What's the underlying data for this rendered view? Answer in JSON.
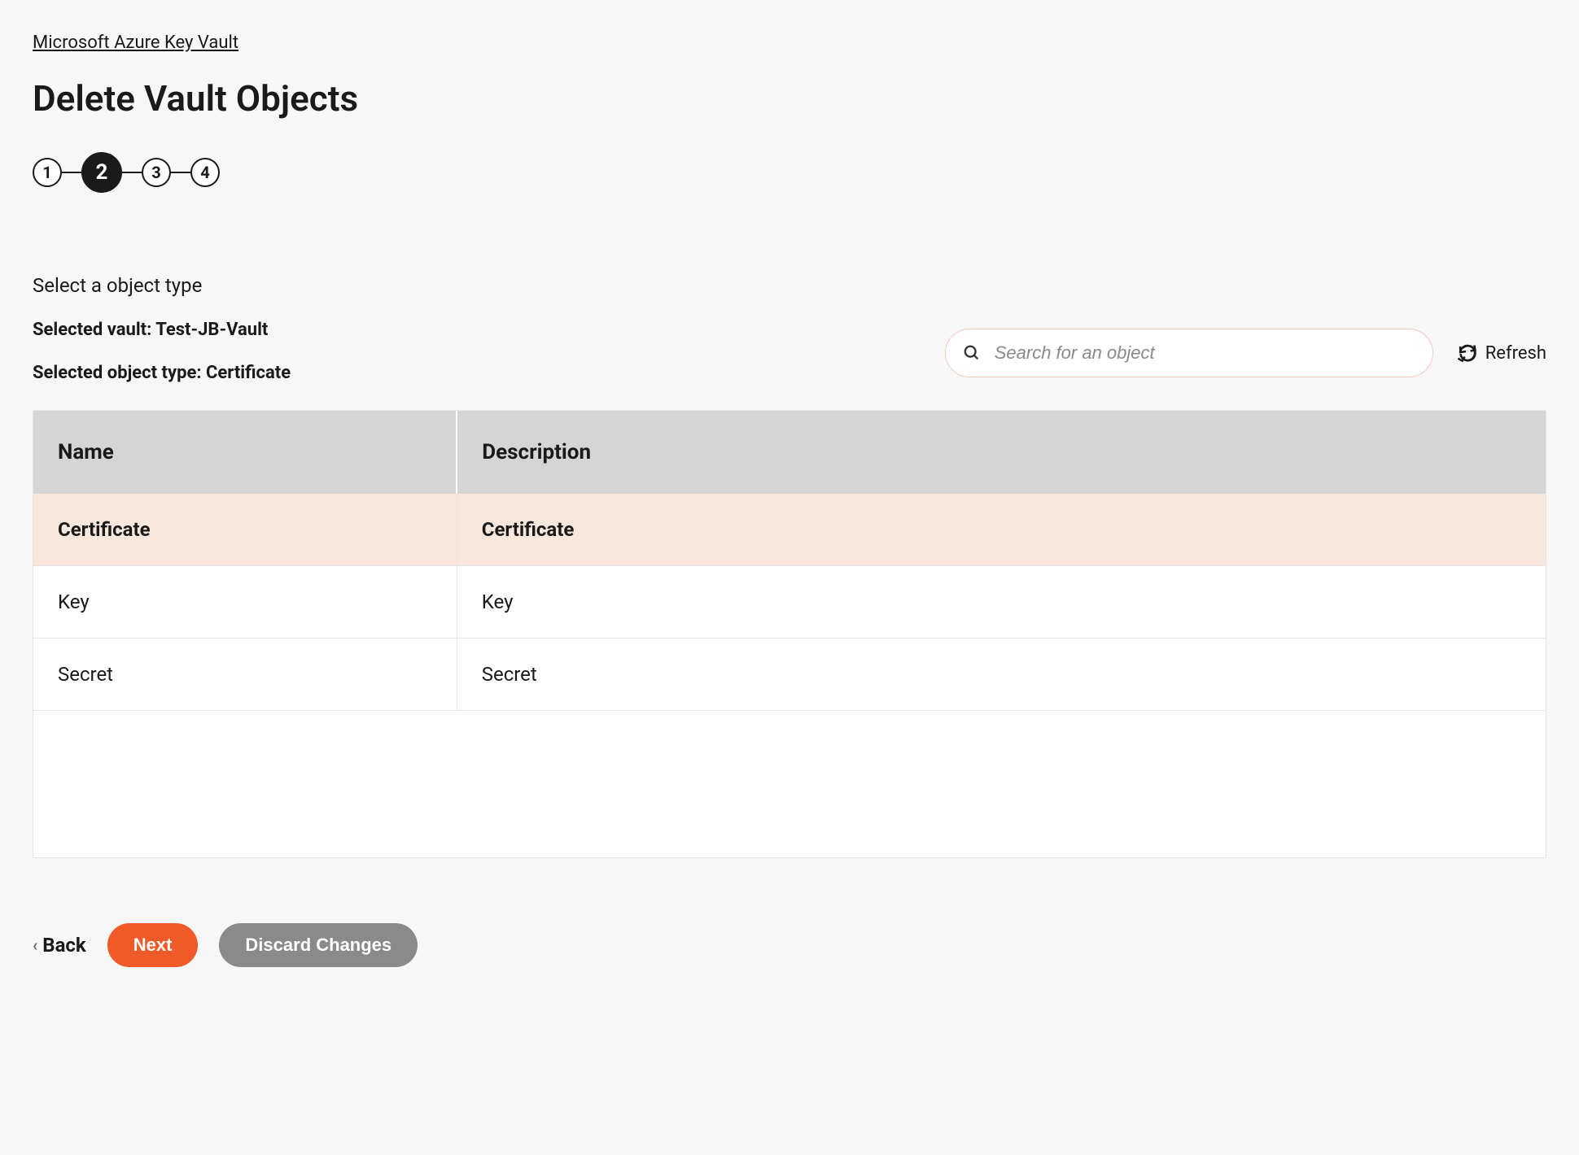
{
  "breadcrumb": "Microsoft Azure Key Vault",
  "page_title": "Delete Vault Objects",
  "stepper": {
    "steps": [
      "1",
      "2",
      "3",
      "4"
    ],
    "active_index": 1
  },
  "info": {
    "prompt": "Select a object type",
    "selected_vault_label": "Selected vault: Test-JB-Vault",
    "selected_object_type_label": "Selected object type: Certificate"
  },
  "search": {
    "placeholder": "Search for an object"
  },
  "refresh_label": "Refresh",
  "table": {
    "headers": {
      "name": "Name",
      "description": "Description"
    },
    "rows": [
      {
        "name": "Certificate",
        "description": "Certificate",
        "selected": true
      },
      {
        "name": "Key",
        "description": "Key",
        "selected": false
      },
      {
        "name": "Secret",
        "description": "Secret",
        "selected": false
      }
    ]
  },
  "footer": {
    "back_label": "Back",
    "next_label": "Next",
    "discard_label": "Discard Changes"
  }
}
